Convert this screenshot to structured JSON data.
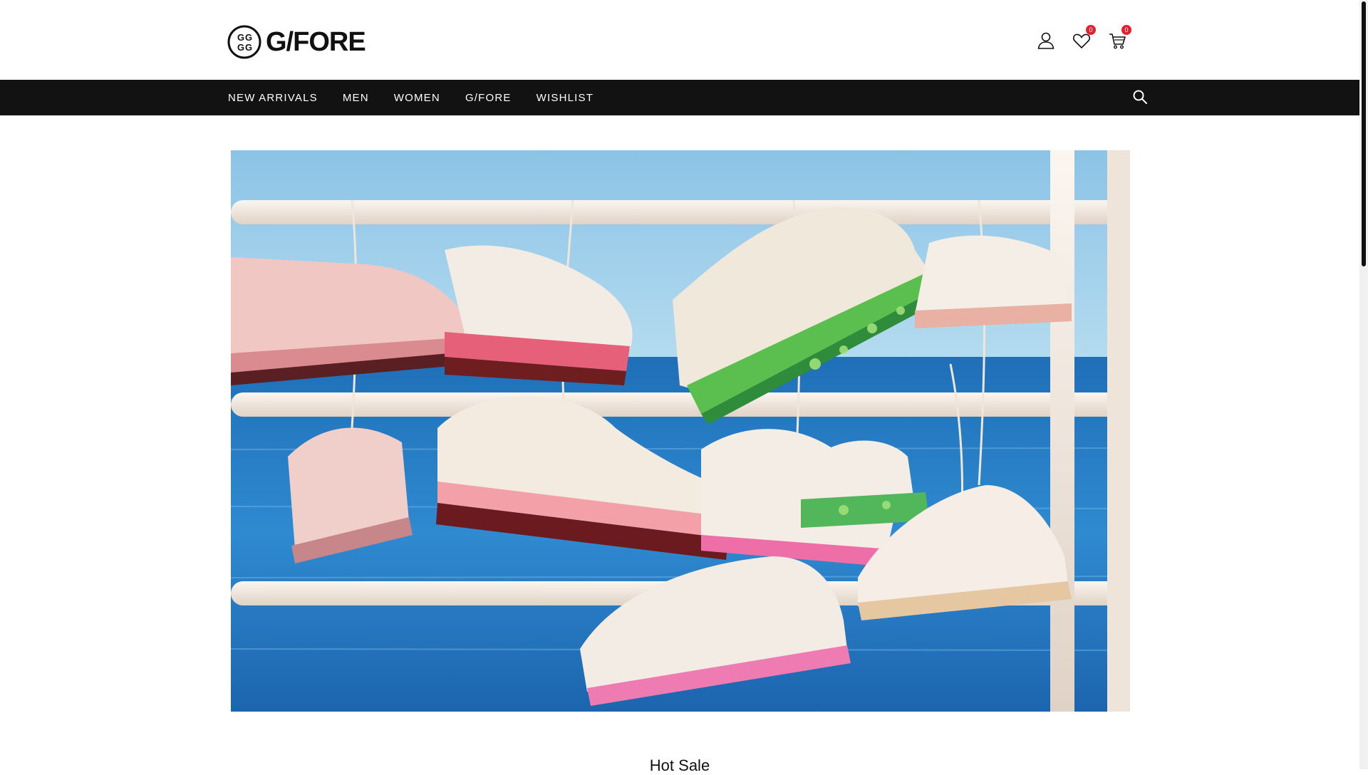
{
  "brand": {
    "name": "G/FORE",
    "logo_icon": "gfore-monogram-icon"
  },
  "header": {
    "icons": [
      {
        "name": "account-icon"
      },
      {
        "name": "wishlist-heart-icon",
        "badge": "0"
      },
      {
        "name": "cart-icon",
        "badge": "0"
      }
    ]
  },
  "nav": {
    "items": [
      "NEW ARRIVALS",
      "MEN",
      "WOMEN",
      "G/FORE",
      "WISHLIST"
    ],
    "search_icon": "search-icon"
  },
  "hero": {
    "image": "golf shoes hanging on railing over sea",
    "colors": {
      "sky": "#7fb8e0",
      "sea": "#2a7fc4",
      "rail": "#f1e9e1"
    }
  },
  "sections": {
    "hot_sale_title": "Hot Sale"
  },
  "colors": {
    "nav_bg": "#121212",
    "badge": "#e5202e",
    "text": "#111111"
  }
}
